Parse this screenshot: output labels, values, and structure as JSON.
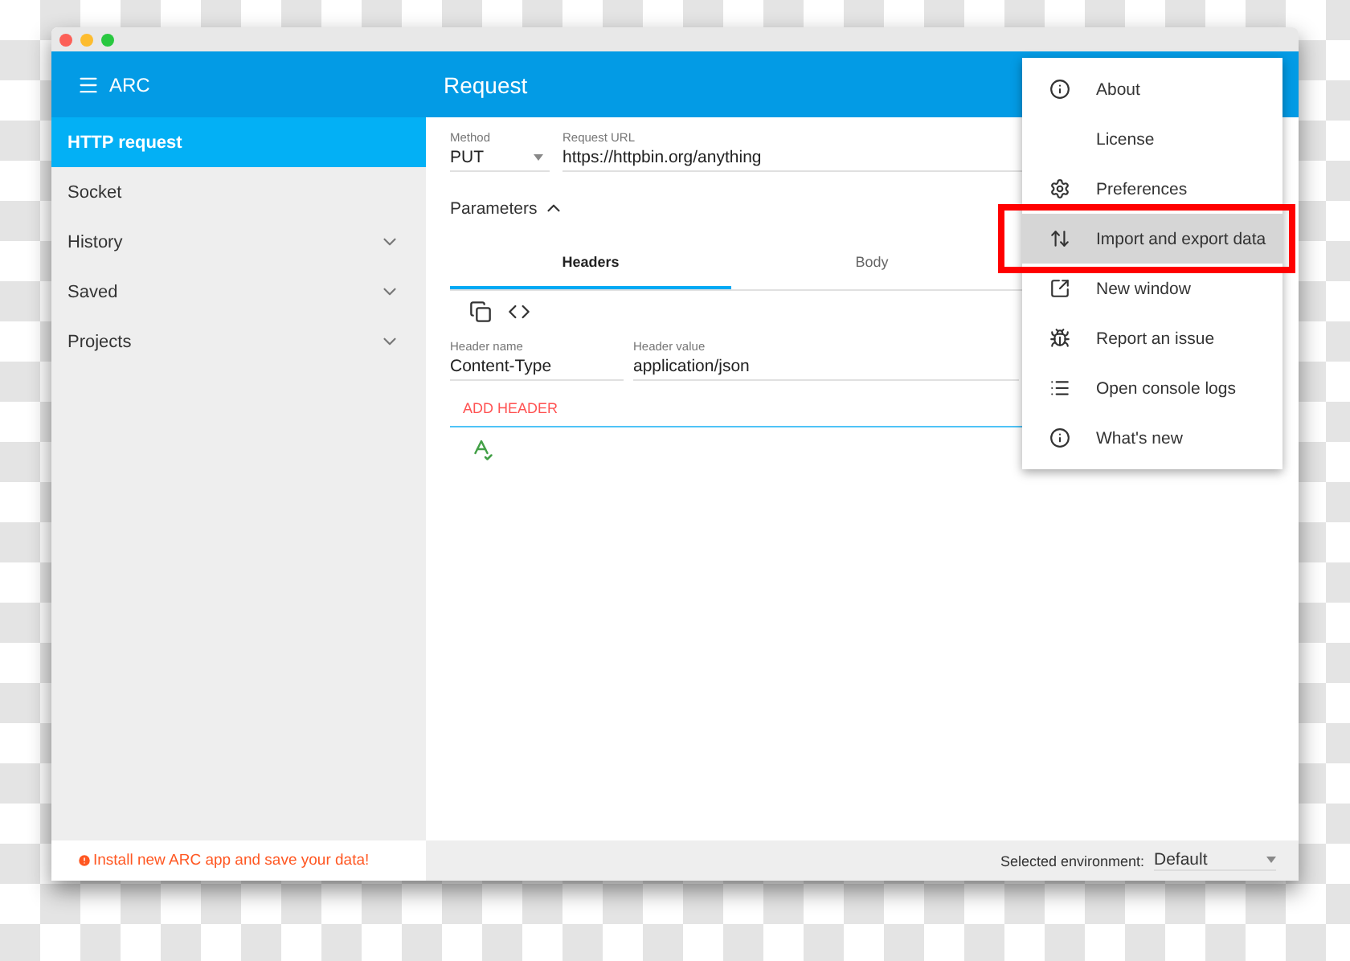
{
  "app": {
    "title": "ARC"
  },
  "toolbar": {
    "title": "Request"
  },
  "sidebar": {
    "items": [
      {
        "label": "HTTP request",
        "selected": true,
        "kind": "link"
      },
      {
        "label": "Socket",
        "selected": false,
        "kind": "link"
      },
      {
        "label": "History",
        "selected": false,
        "kind": "group"
      },
      {
        "label": "Saved",
        "selected": false,
        "kind": "group"
      },
      {
        "label": "Projects",
        "selected": false,
        "kind": "group"
      }
    ],
    "notice": "Install new ARC app and save your data!"
  },
  "request": {
    "method": {
      "label": "Method",
      "value": "PUT"
    },
    "url": {
      "label": "Request URL",
      "value": "https://httpbin.org/anything"
    },
    "parameters": {
      "label": "Parameters",
      "expanded": true
    },
    "tabs": [
      {
        "label": "Headers",
        "selected": true
      },
      {
        "label": "Body",
        "selected": false
      }
    ],
    "header_name": {
      "label": "Header name",
      "value": "Content-Type"
    },
    "header_value": {
      "label": "Header value",
      "value": "application/json"
    },
    "add_header": "ADD HEADER"
  },
  "environment": {
    "label": "Selected environment:",
    "value": "Default"
  },
  "menu": {
    "items": [
      {
        "label": "About",
        "highlighted": false
      },
      {
        "label": "License",
        "highlighted": false
      },
      {
        "label": "Preferences",
        "highlighted": false
      },
      {
        "label": "Import and export data",
        "highlighted": true
      },
      {
        "label": "New window",
        "highlighted": false
      },
      {
        "label": "Report an issue",
        "highlighted": false
      },
      {
        "label": "Open console logs",
        "highlighted": false
      },
      {
        "label": "What's new",
        "highlighted": false
      }
    ]
  }
}
